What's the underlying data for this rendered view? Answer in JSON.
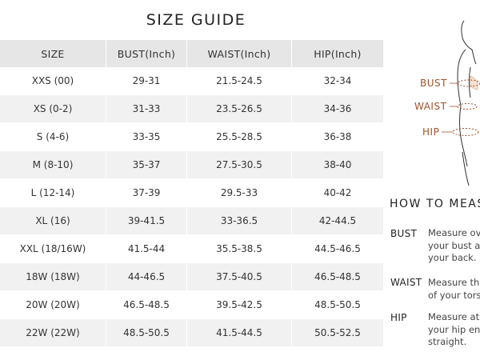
{
  "title": "SIZE GUIDE",
  "table": {
    "headers": [
      "SIZE",
      "BUST(Inch)",
      "WAIST(Inch)",
      "HIP(Inch)"
    ],
    "rows": [
      [
        "XXS (00)",
        "29-31",
        "21.5-24.5",
        "32-34"
      ],
      [
        "XS (0-2)",
        "31-33",
        "23.5-26.5",
        "34-36"
      ],
      [
        "S (4-6)",
        "33-35",
        "25.5-28.5",
        "36-38"
      ],
      [
        "M (8-10)",
        "35-37",
        "27.5-30.5",
        "38-40"
      ],
      [
        "L (12-14)",
        "37-39",
        "29.5-33",
        "40-42"
      ],
      [
        "XL (16)",
        "39-41.5",
        "33-36.5",
        "42-44.5"
      ],
      [
        "XXL (18/16W)",
        "41.5-44",
        "35.5-38.5",
        "44.5-46.5"
      ],
      [
        "18W (18W)",
        "44-46.5",
        "37.5-40.5",
        "46.5-48.5"
      ],
      [
        "20W (20W)",
        "46.5-48.5",
        "39.5-42.5",
        "48.5-50.5"
      ],
      [
        "22W (22W)",
        "48.5-50.5",
        "41.5-44.5",
        "50.5-52.5"
      ]
    ]
  },
  "figure": {
    "labels": {
      "bust": "BUST",
      "waist": "WAIST",
      "hip": "HIP"
    },
    "accent_color": "#a0522d"
  },
  "how_to": {
    "title": "HOW TO MEAS",
    "items": [
      {
        "term": "BUST",
        "lines": [
          "Measure ove",
          "your bust an",
          "your back."
        ]
      },
      {
        "term": "WAIST",
        "lines": [
          "Measure th",
          "of your tors"
        ]
      },
      {
        "term": "HIP",
        "lines": [
          "Measure at",
          "your hip en",
          "straight."
        ]
      }
    ]
  }
}
